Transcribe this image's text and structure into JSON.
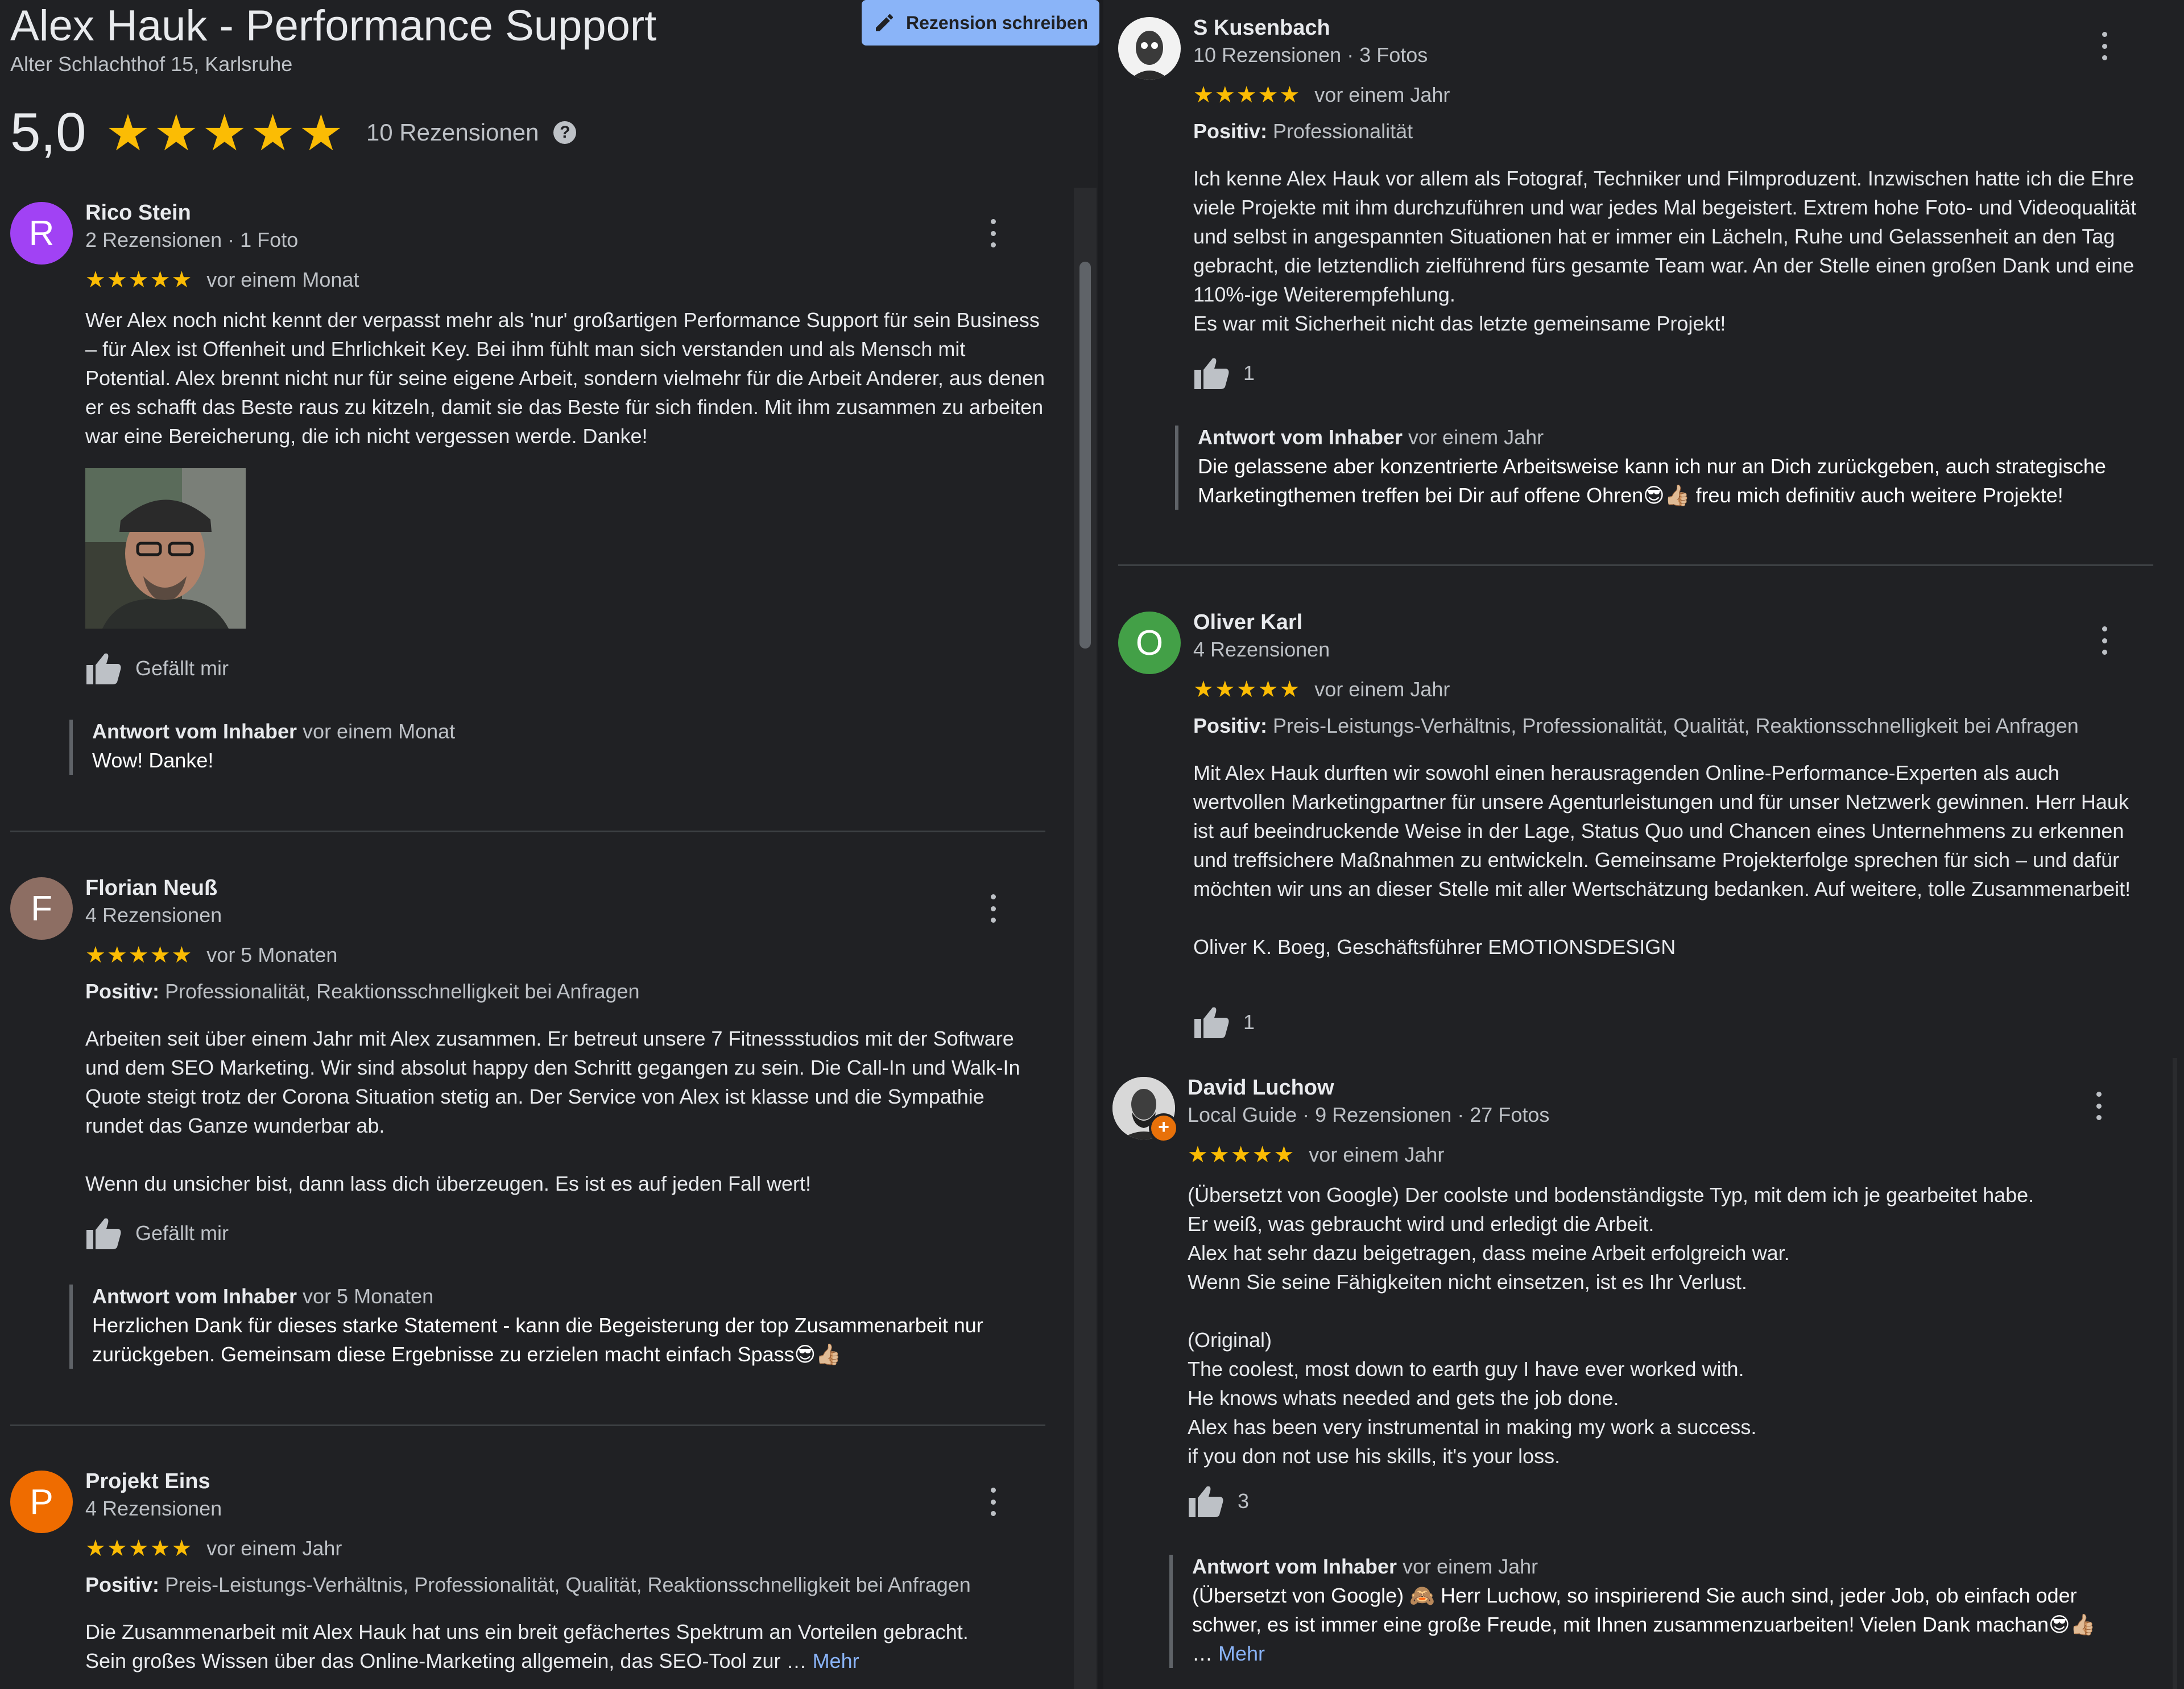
{
  "header": {
    "title": "Alex Hauk - Performance Support",
    "address": "Alter Schlachthof 15, Karlsruhe",
    "write_review": "Rezension schreiben",
    "rating": "5,0",
    "stars": "★★★★★",
    "review_count": "10 Rezensionen",
    "help": "?"
  },
  "reviews": [
    {
      "initial": "R",
      "avatar_color": "#a142f4",
      "name": "Rico Stein",
      "meta": "2 Rezensionen · 1 Foto",
      "stars": "★★★★★",
      "when": "vor einem Monat",
      "text": "Wer Alex noch nicht kennt der verpasst mehr als 'nur' großartigen Performance Support für sein Business – für Alex ist Offenheit und Ehrlichkeit Key. Bei ihm fühlt man sich verstanden und als Mensch mit Potential. Alex brennt nicht nur für seine eigene Arbeit, sondern vielmehr für die Arbeit Anderer, aus denen er es schafft das Beste raus zu kitzeln, damit sie das Beste für sich finden. Mit ihm zusammen zu arbeiten war eine Bereicherung, die ich nicht vergessen werde. Danke!",
      "like": "Gefällt mir",
      "owner_label": "Antwort vom Inhaber",
      "owner_when": "vor einem Monat",
      "owner_text": "Wow! Danke!"
    },
    {
      "initial": "F",
      "avatar_color": "#8d6e63",
      "name": "Florian Neuß",
      "meta": "4 Rezensionen",
      "stars": "★★★★★",
      "when": "vor 5 Monaten",
      "positive_label": "Positiv:",
      "positive_text": "Professionalität, Reaktionsschnelligkeit bei Anfragen",
      "text1": "Arbeiten seit über einem Jahr mit Alex zusammen. Er betreut unsere 7 Fitnessstudios mit der Software und dem SEO Marketing. Wir sind absolut happy den Schritt gegangen zu sein. Die Call-In und Walk-In Quote steigt trotz der Corona Situation stetig an. Der Service von Alex ist klasse und die Sympathie rundet das Ganze wunderbar ab.",
      "text2": "Wenn du unsicher bist, dann lass dich überzeugen. Es ist es auf jeden Fall wert!",
      "like": "Gefällt mir",
      "owner_label": "Antwort vom Inhaber",
      "owner_when": "vor 5 Monaten",
      "owner_text": "Herzlichen Dank für dieses starke Statement - kann die Begeisterung der top Zusammenarbeit nur zurückgeben. Gemeinsam diese Ergebnisse zu erzielen macht einfach Spass😎👍🏼"
    },
    {
      "initial": "P",
      "avatar_color": "#ef6c00",
      "name": "Projekt Eins",
      "meta": "4 Rezensionen",
      "stars": "★★★★★",
      "when": "vor einem Jahr",
      "positive_label": "Positiv:",
      "positive_text": "Preis-Leistungs-Verhältnis, Professionalität, Qualität, Reaktionsschnelligkeit bei Anfragen",
      "text1": "Die Zusammenarbeit mit Alex Hauk hat uns ein breit gefächertes Spektrum an Vorteilen gebracht.",
      "text2": "Sein großes Wissen über das Online-Marketing allgemein, das SEO-Tool zur …",
      "more": "Mehr"
    },
    {
      "name": "S Kusenbach",
      "meta": "10 Rezensionen · 3 Fotos",
      "stars": "★★★★★",
      "when": "vor einem Jahr",
      "positive_label": "Positiv:",
      "positive_text": "Professionalität",
      "text1": "Ich kenne Alex Hauk vor allem als Fotograf, Techniker und Filmproduzent. Inzwischen hatte ich die Ehre viele Projekte mit ihm durchzuführen und war jedes Mal begeistert. Extrem hohe Foto- und Videoqualität und selbst in angespannten Situationen hat er immer ein Lächeln, Ruhe und Gelassenheit an den Tag gebracht, die letztendlich zielführend fürs gesamte Team war. An der Stelle einen großen Dank und eine 110%-ige Weiterempfehlung.",
      "text2": "Es war mit Sicherheit nicht das letzte gemeinsame Projekt!",
      "likes": "1",
      "owner_label": "Antwort vom Inhaber",
      "owner_when": "vor einem Jahr",
      "owner_text": "Die gelassene aber konzentrierte Arbeitsweise kann ich nur an Dich zurückgeben, auch strategische Marketingthemen treffen bei Dir auf offene Ohren😎👍🏼 freu mich definitiv auch weitere Projekte!"
    },
    {
      "initial": "O",
      "avatar_color": "#43a047",
      "name": "Oliver Karl",
      "meta": "4 Rezensionen",
      "stars": "★★★★★",
      "when": "vor einem Jahr",
      "positive_label": "Positiv:",
      "positive_text": "Preis-Leistungs-Verhältnis, Professionalität, Qualität, Reaktionsschnelligkeit bei Anfragen",
      "text1": "Mit Alex Hauk durften wir sowohl einen herausragenden Online-Performance-Experten als auch wertvollen Marketingpartner für unsere Agenturleistungen und für unser Netzwerk gewinnen. Herr Hauk ist auf beeindruckende Weise in der Lage, Status Quo und Chancen eines Unternehmens zu erkennen und treffsichere Maßnahmen zu entwickeln. Gemeinsame Projekterfolge sprechen für sich – und dafür möchten wir uns an dieser Stelle mit aller Wertschätzung bedanken. Auf weitere, tolle Zusammenarbeit!",
      "text2": "Oliver K. Boeg, Geschäftsführer EMOTIONSDESIGN",
      "likes": "1"
    },
    {
      "name": "David Luchow",
      "meta": "Local Guide · 9 Rezensionen · 27 Fotos",
      "stars": "★★★★★",
      "when": "vor einem Jahr",
      "lines": [
        "(Übersetzt von Google) Der coolste und bodenständigste Typ, mit dem ich je gearbeitet habe.",
        "Er weiß, was gebraucht wird und erledigt die Arbeit.",
        "Alex hat sehr dazu beigetragen, dass meine Arbeit erfolgreich war.",
        "Wenn Sie seine Fähigkeiten nicht einsetzen, ist es Ihr Verlust.",
        "",
        "(Original)",
        "The coolest, most down to earth guy I have ever worked with.",
        "He knows whats needed and gets the job done.",
        "Alex has been very instrumental in making my work a success.",
        "if you don not  use his skills, it's your loss."
      ],
      "likes": "3",
      "owner_label": "Antwort vom Inhaber",
      "owner_when": "vor einem Jahr",
      "owner_text": "(Übersetzt von Google) 🙈 Herr Luchow, so inspirierend Sie auch sind, jeder Job, ob einfach oder schwer, es ist immer eine große Freude, mit Ihnen zusammenzuarbeiten! Vielen Dank machan😎👍🏼",
      "owner_more_prefix": "…",
      "more": "Mehr"
    }
  ]
}
